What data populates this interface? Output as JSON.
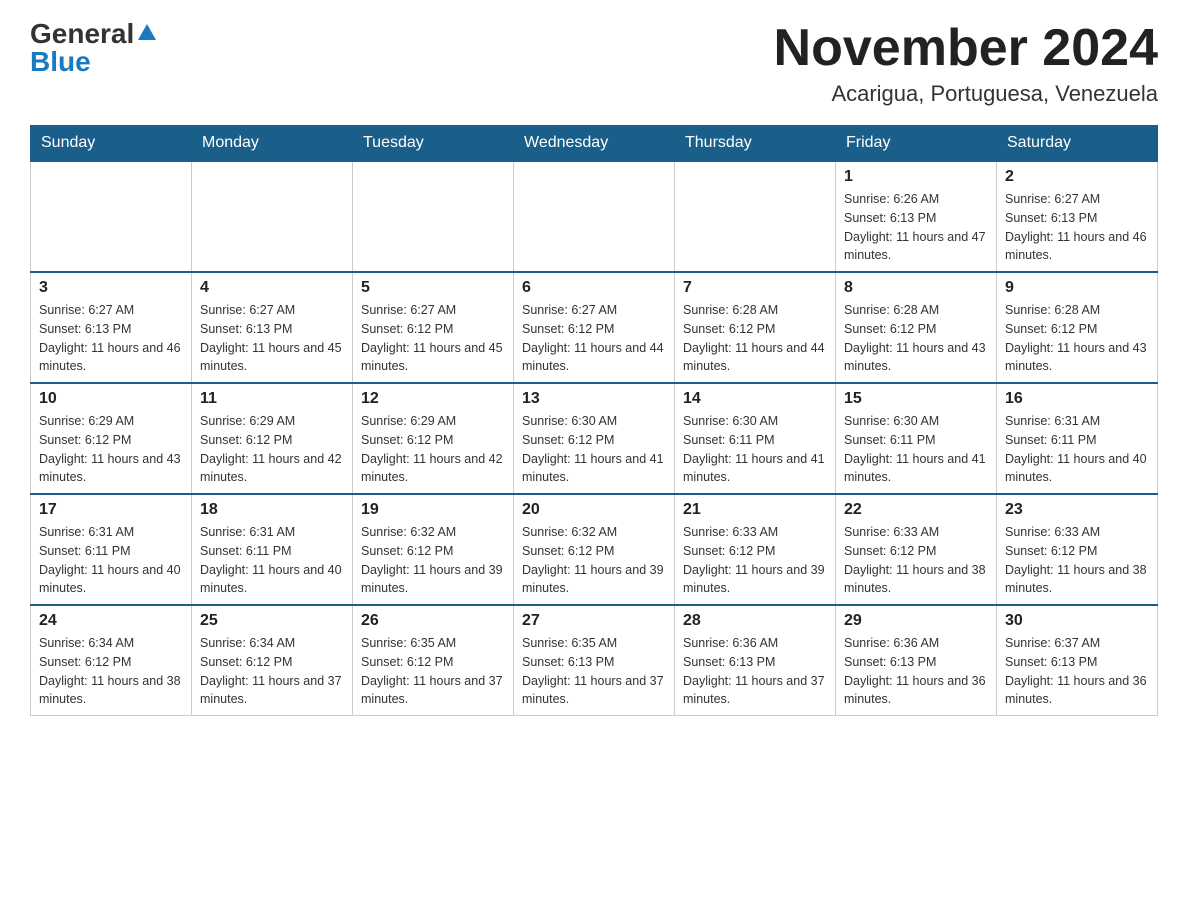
{
  "header": {
    "logo_general": "General",
    "logo_blue": "Blue",
    "month_title": "November 2024",
    "location": "Acarigua, Portuguesa, Venezuela"
  },
  "days_of_week": [
    "Sunday",
    "Monday",
    "Tuesday",
    "Wednesday",
    "Thursday",
    "Friday",
    "Saturday"
  ],
  "weeks": [
    [
      {
        "day": "",
        "info": ""
      },
      {
        "day": "",
        "info": ""
      },
      {
        "day": "",
        "info": ""
      },
      {
        "day": "",
        "info": ""
      },
      {
        "day": "",
        "info": ""
      },
      {
        "day": "1",
        "info": "Sunrise: 6:26 AM\nSunset: 6:13 PM\nDaylight: 11 hours and 47 minutes."
      },
      {
        "day": "2",
        "info": "Sunrise: 6:27 AM\nSunset: 6:13 PM\nDaylight: 11 hours and 46 minutes."
      }
    ],
    [
      {
        "day": "3",
        "info": "Sunrise: 6:27 AM\nSunset: 6:13 PM\nDaylight: 11 hours and 46 minutes."
      },
      {
        "day": "4",
        "info": "Sunrise: 6:27 AM\nSunset: 6:13 PM\nDaylight: 11 hours and 45 minutes."
      },
      {
        "day": "5",
        "info": "Sunrise: 6:27 AM\nSunset: 6:12 PM\nDaylight: 11 hours and 45 minutes."
      },
      {
        "day": "6",
        "info": "Sunrise: 6:27 AM\nSunset: 6:12 PM\nDaylight: 11 hours and 44 minutes."
      },
      {
        "day": "7",
        "info": "Sunrise: 6:28 AM\nSunset: 6:12 PM\nDaylight: 11 hours and 44 minutes."
      },
      {
        "day": "8",
        "info": "Sunrise: 6:28 AM\nSunset: 6:12 PM\nDaylight: 11 hours and 43 minutes."
      },
      {
        "day": "9",
        "info": "Sunrise: 6:28 AM\nSunset: 6:12 PM\nDaylight: 11 hours and 43 minutes."
      }
    ],
    [
      {
        "day": "10",
        "info": "Sunrise: 6:29 AM\nSunset: 6:12 PM\nDaylight: 11 hours and 43 minutes."
      },
      {
        "day": "11",
        "info": "Sunrise: 6:29 AM\nSunset: 6:12 PM\nDaylight: 11 hours and 42 minutes."
      },
      {
        "day": "12",
        "info": "Sunrise: 6:29 AM\nSunset: 6:12 PM\nDaylight: 11 hours and 42 minutes."
      },
      {
        "day": "13",
        "info": "Sunrise: 6:30 AM\nSunset: 6:12 PM\nDaylight: 11 hours and 41 minutes."
      },
      {
        "day": "14",
        "info": "Sunrise: 6:30 AM\nSunset: 6:11 PM\nDaylight: 11 hours and 41 minutes."
      },
      {
        "day": "15",
        "info": "Sunrise: 6:30 AM\nSunset: 6:11 PM\nDaylight: 11 hours and 41 minutes."
      },
      {
        "day": "16",
        "info": "Sunrise: 6:31 AM\nSunset: 6:11 PM\nDaylight: 11 hours and 40 minutes."
      }
    ],
    [
      {
        "day": "17",
        "info": "Sunrise: 6:31 AM\nSunset: 6:11 PM\nDaylight: 11 hours and 40 minutes."
      },
      {
        "day": "18",
        "info": "Sunrise: 6:31 AM\nSunset: 6:11 PM\nDaylight: 11 hours and 40 minutes."
      },
      {
        "day": "19",
        "info": "Sunrise: 6:32 AM\nSunset: 6:12 PM\nDaylight: 11 hours and 39 minutes."
      },
      {
        "day": "20",
        "info": "Sunrise: 6:32 AM\nSunset: 6:12 PM\nDaylight: 11 hours and 39 minutes."
      },
      {
        "day": "21",
        "info": "Sunrise: 6:33 AM\nSunset: 6:12 PM\nDaylight: 11 hours and 39 minutes."
      },
      {
        "day": "22",
        "info": "Sunrise: 6:33 AM\nSunset: 6:12 PM\nDaylight: 11 hours and 38 minutes."
      },
      {
        "day": "23",
        "info": "Sunrise: 6:33 AM\nSunset: 6:12 PM\nDaylight: 11 hours and 38 minutes."
      }
    ],
    [
      {
        "day": "24",
        "info": "Sunrise: 6:34 AM\nSunset: 6:12 PM\nDaylight: 11 hours and 38 minutes."
      },
      {
        "day": "25",
        "info": "Sunrise: 6:34 AM\nSunset: 6:12 PM\nDaylight: 11 hours and 37 minutes."
      },
      {
        "day": "26",
        "info": "Sunrise: 6:35 AM\nSunset: 6:12 PM\nDaylight: 11 hours and 37 minutes."
      },
      {
        "day": "27",
        "info": "Sunrise: 6:35 AM\nSunset: 6:13 PM\nDaylight: 11 hours and 37 minutes."
      },
      {
        "day": "28",
        "info": "Sunrise: 6:36 AM\nSunset: 6:13 PM\nDaylight: 11 hours and 37 minutes."
      },
      {
        "day": "29",
        "info": "Sunrise: 6:36 AM\nSunset: 6:13 PM\nDaylight: 11 hours and 36 minutes."
      },
      {
        "day": "30",
        "info": "Sunrise: 6:37 AM\nSunset: 6:13 PM\nDaylight: 11 hours and 36 minutes."
      }
    ]
  ]
}
